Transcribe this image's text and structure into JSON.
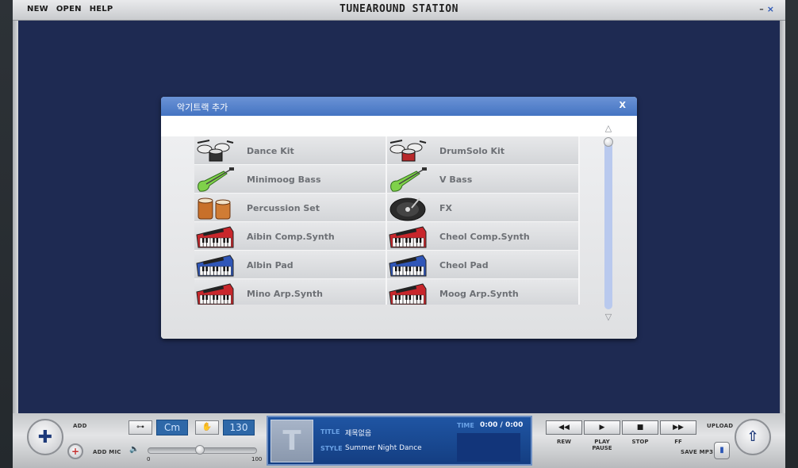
{
  "menu": {
    "new": "NEW",
    "open": "OPEN",
    "help": "HELP"
  },
  "app_title": "TUNEAROUND STATION",
  "window": {
    "min": "–",
    "close": "×"
  },
  "modal": {
    "title": "악기트랙 추가",
    "close": "X",
    "items": [
      {
        "label": "Dance Kit",
        "icon": "drum-kit-icon"
      },
      {
        "label": "DrumSolo Kit",
        "icon": "drum-kit-red-icon"
      },
      {
        "label": "Minimoog Bass",
        "icon": "bass-guitar-icon"
      },
      {
        "label": "V Bass",
        "icon": "bass-guitar-icon"
      },
      {
        "label": "Percussion Set",
        "icon": "bongo-icon"
      },
      {
        "label": "FX",
        "icon": "turntable-icon"
      },
      {
        "label": "Aibin Comp.Synth",
        "icon": "red-synth-icon"
      },
      {
        "label": "Cheol Comp.Synth",
        "icon": "red-synth-icon"
      },
      {
        "label": "Albin Pad",
        "icon": "blue-synth-icon"
      },
      {
        "label": "Cheol Pad",
        "icon": "blue-synth-icon"
      },
      {
        "label": "Mino Arp.Synth",
        "icon": "red-synth-icon"
      },
      {
        "label": "Moog Arp.Synth",
        "icon": "red-synth-icon"
      }
    ],
    "scroll_up": "△",
    "scroll_down": "▽"
  },
  "bottom": {
    "add": "ADD",
    "add_mic": "ADD MIC",
    "key_icon": "⊶",
    "key": "Cm",
    "tempo_icon": "✋",
    "tempo": "130",
    "volume_icon": "🔈",
    "volume_min": "0",
    "volume_max": "100",
    "volume_level": 0.48,
    "now_playing": {
      "title_key": "TITLE",
      "title": "제목없음",
      "style_key": "STYLE",
      "style": "Summer Night Dance",
      "time_key": "TIME",
      "time": "0:00 / 0:00",
      "thumb": "T"
    },
    "transport": [
      {
        "glyph": "◀◀",
        "label": "REW"
      },
      {
        "glyph": "▶",
        "label": "PLAY PAUSE"
      },
      {
        "glyph": "■",
        "label": "STOP"
      },
      {
        "glyph": "▶▶",
        "label": "FF"
      }
    ],
    "upload": "UPLOAD",
    "save_mp3": "SAVE MP3"
  }
}
